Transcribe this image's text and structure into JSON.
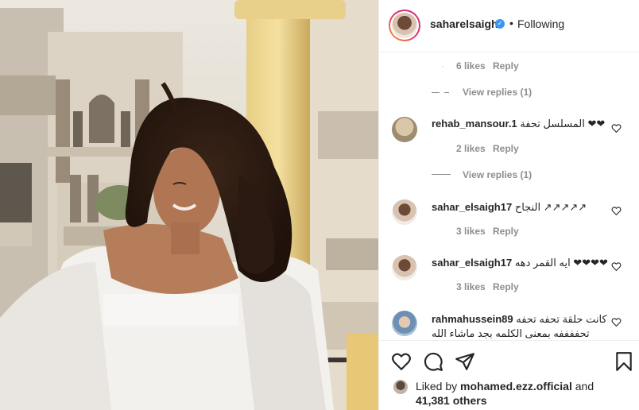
{
  "header": {
    "username": "saharelsaigh",
    "dot": "•",
    "follow_status": "Following"
  },
  "comments": {
    "reply_block_1": {
      "likes": "6 likes",
      "reply": "Reply",
      "view_replies": "View replies (1)"
    },
    "c1": {
      "user": "rehab_mansour.1",
      "text": "المسلسل تحفة ❤❤",
      "likes": "2 likes",
      "reply": "Reply",
      "view_replies": "View replies (1)"
    },
    "c2": {
      "user": "sahar_elsaigh17",
      "text": "النجاح ↗↗↗↗↗",
      "likes": "3 likes",
      "reply": "Reply"
    },
    "c3": {
      "user": "sahar_elsaigh17",
      "text": "ايه القمر دهه ❤❤❤❤",
      "likes": "3 likes",
      "reply": "Reply"
    },
    "c4": {
      "user": "rahmahussein89",
      "text": "كانت حلقة تحفه تحفه تحففففه بمعنى الكلمه بجد ماشاء الله"
    }
  },
  "actions": {
    "liked_prefix": "Liked by ",
    "liked_user": "mohamed.ezz.official",
    "liked_and": " and",
    "liked_others": "41,381 others"
  },
  "icons": [
    "heart-icon",
    "comment-icon",
    "share-icon",
    "bookmark-icon",
    "verified-badge-icon"
  ],
  "colors": {
    "accent": "#3897f0",
    "muted": "#8e8e8e",
    "text": "#262626"
  }
}
